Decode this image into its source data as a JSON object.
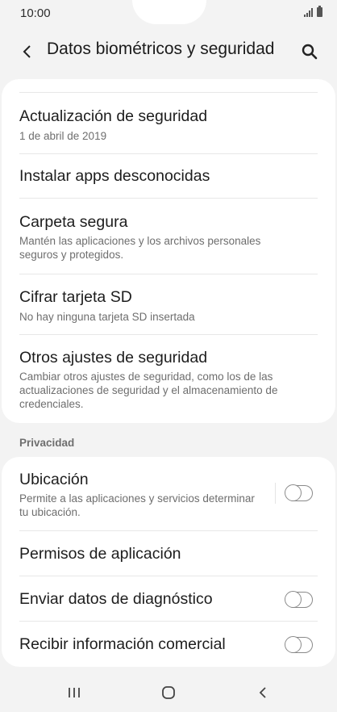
{
  "status_bar": {
    "time": "10:00"
  },
  "header": {
    "title": "Datos biométricos y seguridad"
  },
  "security_items": [
    {
      "title": "Actualización de seguridad",
      "subtitle": "1 de abril de 2019"
    },
    {
      "title": "Instalar apps desconocidas"
    },
    {
      "title": "Carpeta segura",
      "subtitle": "Mantén las aplicaciones y los archivos personales seguros y protegidos."
    },
    {
      "title": "Cifrar tarjeta SD",
      "subtitle": "No hay ninguna tarjeta SD insertada"
    },
    {
      "title": "Otros ajustes de seguridad",
      "subtitle": "Cambiar otros ajustes de seguridad, como los de las actualizaciones de seguridad y el almacenamiento de credenciales."
    }
  ],
  "privacy": {
    "header": "Privacidad",
    "items": [
      {
        "title": "Ubicación",
        "subtitle": "Permite a las aplicaciones y servicios determinar tu ubicación.",
        "toggle": "off"
      },
      {
        "title": "Permisos de aplicación"
      },
      {
        "title": "Enviar datos de diagnóstico",
        "toggle": "off"
      },
      {
        "title": "Recibir información comercial",
        "toggle": "off"
      }
    ]
  },
  "icons": {
    "back": "back-arrow-icon",
    "search": "search-icon",
    "signal": "signal-icon",
    "battery": "battery-icon",
    "recents": "recent-apps-icon",
    "home": "home-icon",
    "nav_back": "nav-back-icon"
  },
  "colors": {
    "background": "#f3f3f3",
    "card": "#ffffff",
    "subtitle": "#6e6e6e",
    "toggle_off": "#8a8a8a"
  }
}
